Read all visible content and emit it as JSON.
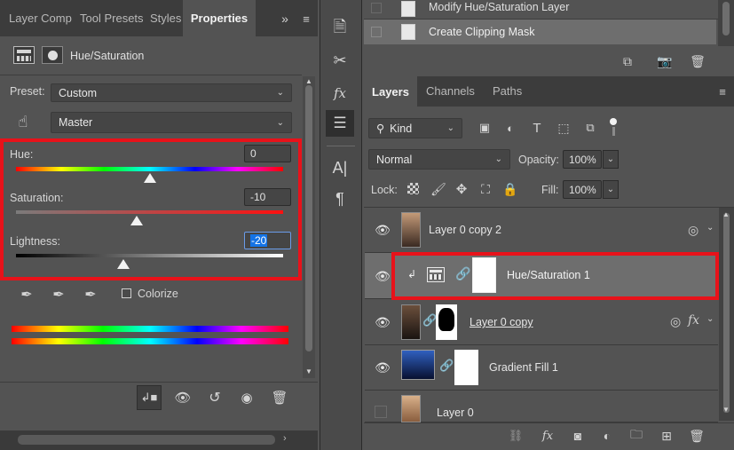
{
  "left_panel": {
    "tabs": [
      "Layer Comp",
      "Tool Presets",
      "Styles",
      "Properties"
    ],
    "adjustment_title": "Hue/Saturation",
    "preset_label": "Preset:",
    "preset_value": "Custom",
    "channel_value": "Master",
    "hue_label": "Hue:",
    "hue_value": "0",
    "hue_level": 0,
    "saturation_label": "Saturation:",
    "saturation_value": "-10",
    "saturation_level": -10,
    "lightness_label": "Lightness:",
    "lightness_value": "-20",
    "lightness_level": -20,
    "colorize_label": "Colorize"
  },
  "history": {
    "items": [
      "Modify Hue/Saturation Layer",
      "Create Clipping Mask"
    ]
  },
  "layers_panel": {
    "tabs": [
      "Layers",
      "Channels",
      "Paths"
    ],
    "filter_kind": "Kind",
    "blend_mode": "Normal",
    "opacity_label": "Opacity:",
    "opacity_value": "100%",
    "lock_label": "Lock:",
    "fill_label": "Fill:",
    "fill_value": "100%",
    "layers": [
      {
        "name": "Layer 0 copy 2"
      },
      {
        "name": "Hue/Saturation 1"
      },
      {
        "name": "Layer 0 copy"
      },
      {
        "name": "Gradient Fill 1"
      },
      {
        "name": "Layer 0"
      }
    ]
  },
  "colors": {
    "highlight_red": "#e8121a",
    "panel": "#535353",
    "selection": "#1473e6"
  }
}
